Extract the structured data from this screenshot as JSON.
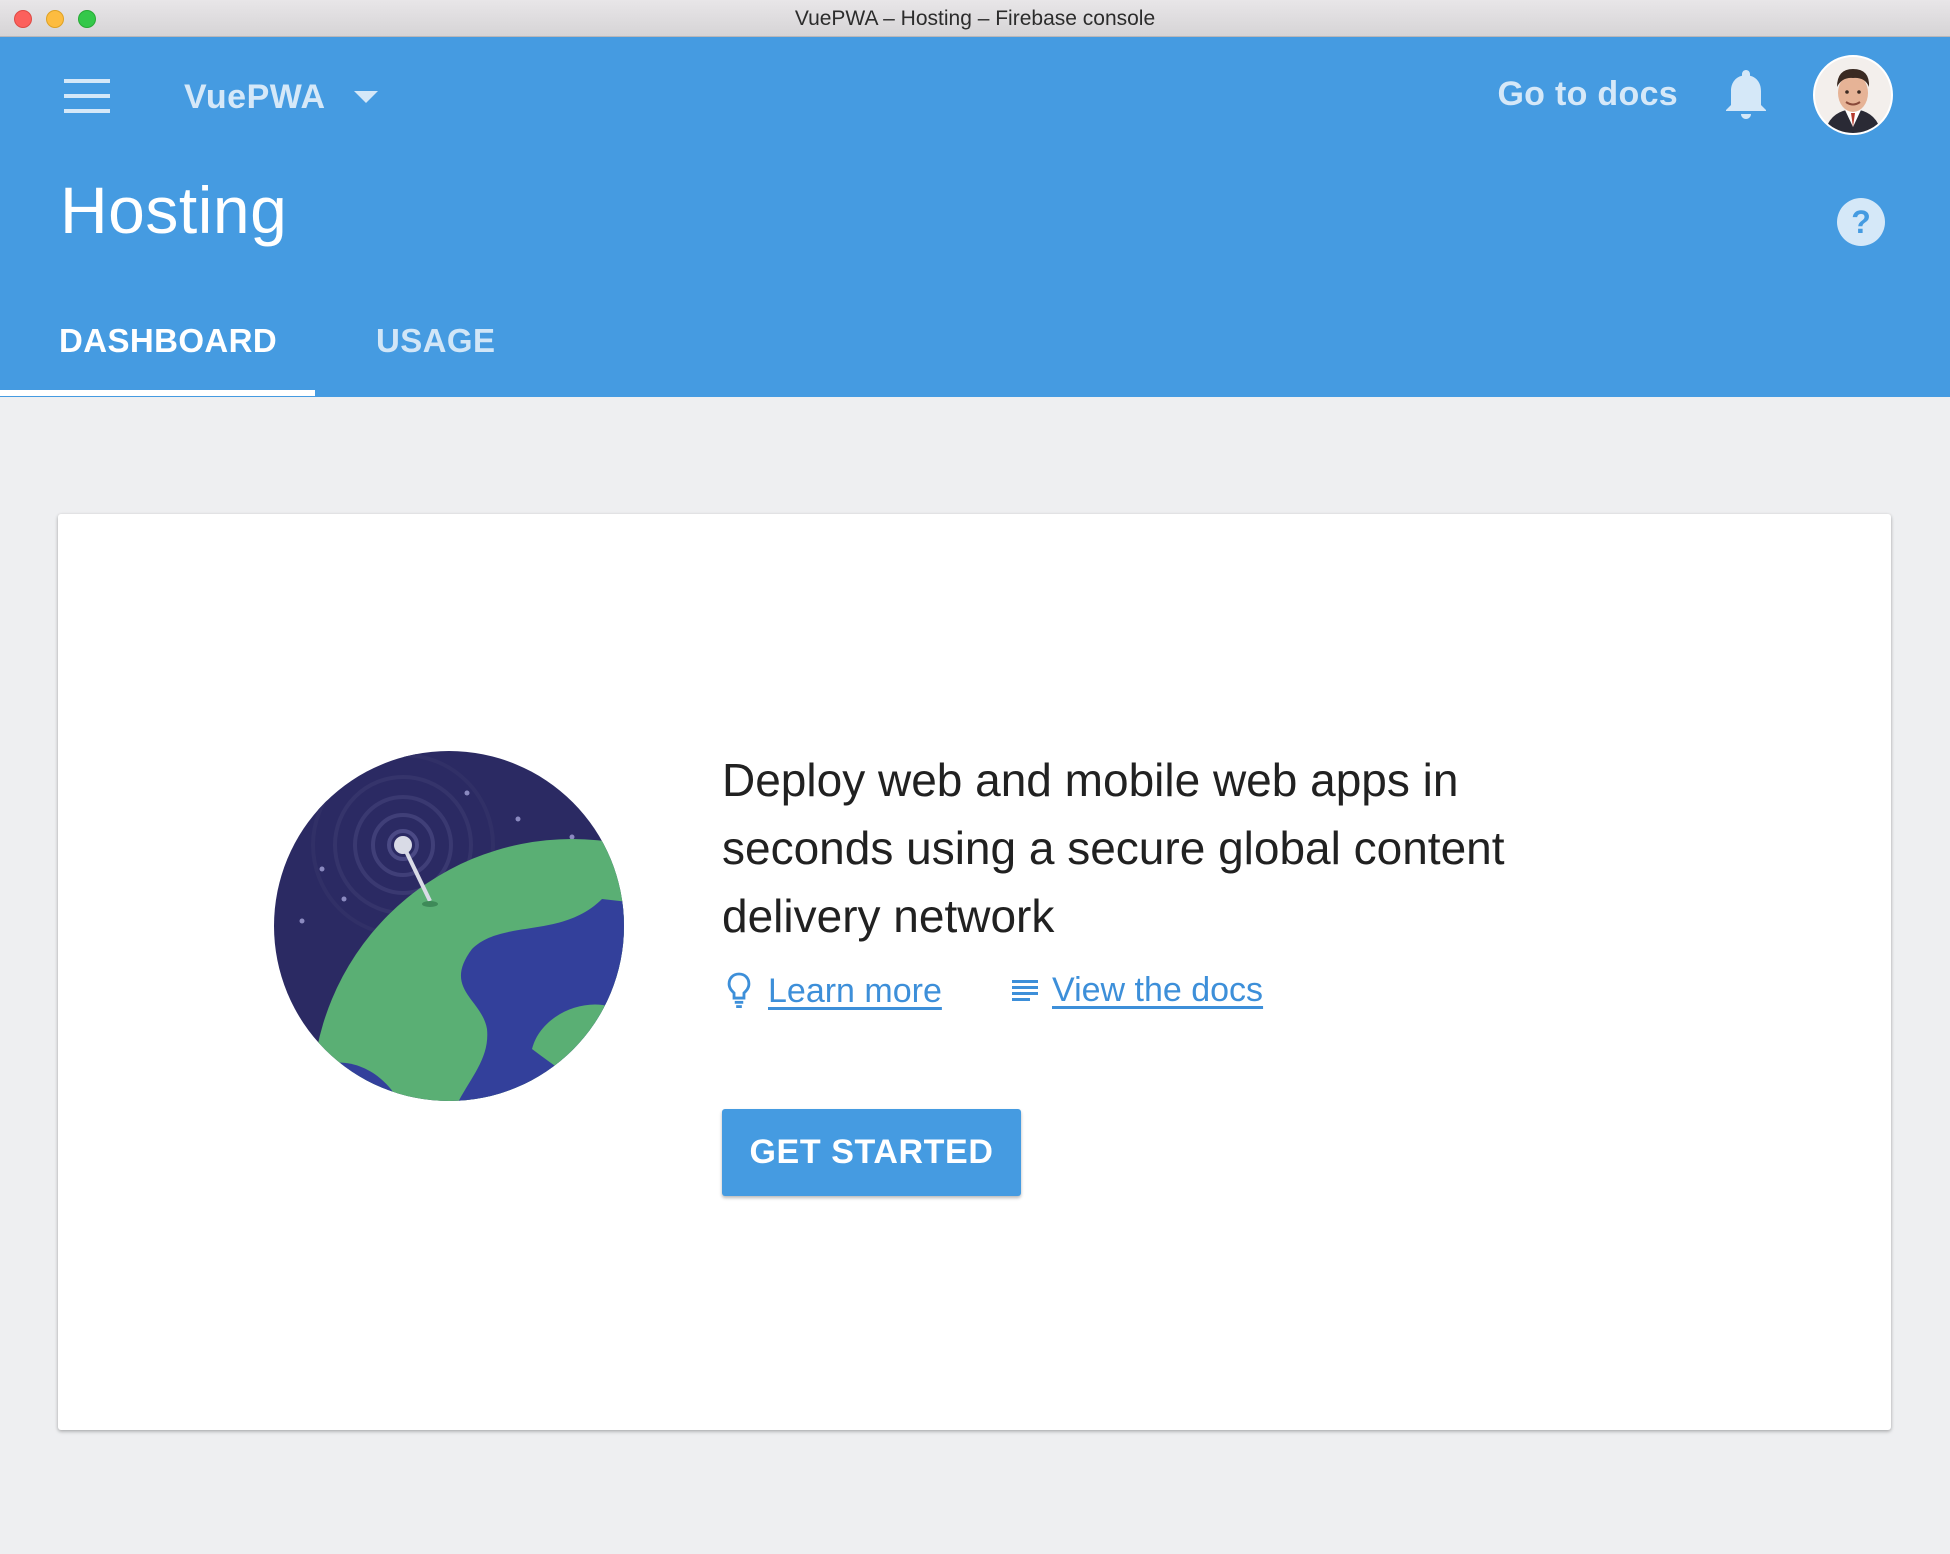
{
  "window": {
    "title": "VuePWA – Hosting – Firebase console"
  },
  "header": {
    "project_name": "VuePWA",
    "docs_link": "Go to docs",
    "page_title": "Hosting",
    "tabs": [
      {
        "label": "DASHBOARD",
        "active": true
      },
      {
        "label": "USAGE",
        "active": false
      }
    ],
    "icons": [
      "menu-icon",
      "chevron-down-icon",
      "bell-icon",
      "avatar",
      "help-icon"
    ]
  },
  "card": {
    "headline": "Deploy web and mobile web apps in seconds using a secure global content delivery network",
    "learn_more": "Learn more",
    "view_docs": "View the docs",
    "cta": "GET STARTED",
    "illustration": "globe-satellite-illustration"
  },
  "colors": {
    "header_bg": "#459be1",
    "page_bg": "#eeeff1",
    "link": "#3d8fd9",
    "button": "#459be1",
    "text": "#212121"
  }
}
